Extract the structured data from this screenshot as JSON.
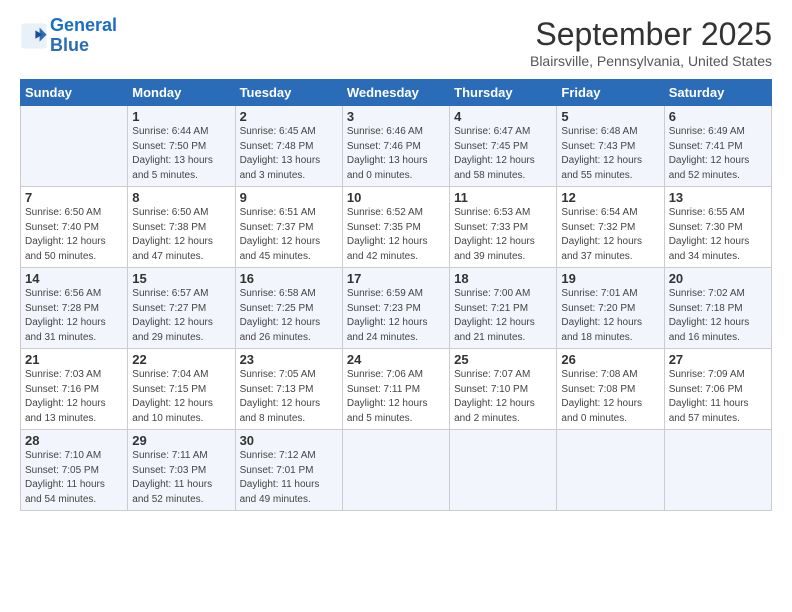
{
  "header": {
    "logo_line1": "General",
    "logo_line2": "Blue",
    "month": "September 2025",
    "location": "Blairsville, Pennsylvania, United States"
  },
  "days_of_week": [
    "Sunday",
    "Monday",
    "Tuesday",
    "Wednesday",
    "Thursday",
    "Friday",
    "Saturday"
  ],
  "weeks": [
    [
      {
        "day": "",
        "info": ""
      },
      {
        "day": "1",
        "info": "Sunrise: 6:44 AM\nSunset: 7:50 PM\nDaylight: 13 hours\nand 5 minutes."
      },
      {
        "day": "2",
        "info": "Sunrise: 6:45 AM\nSunset: 7:48 PM\nDaylight: 13 hours\nand 3 minutes."
      },
      {
        "day": "3",
        "info": "Sunrise: 6:46 AM\nSunset: 7:46 PM\nDaylight: 13 hours\nand 0 minutes."
      },
      {
        "day": "4",
        "info": "Sunrise: 6:47 AM\nSunset: 7:45 PM\nDaylight: 12 hours\nand 58 minutes."
      },
      {
        "day": "5",
        "info": "Sunrise: 6:48 AM\nSunset: 7:43 PM\nDaylight: 12 hours\nand 55 minutes."
      },
      {
        "day": "6",
        "info": "Sunrise: 6:49 AM\nSunset: 7:41 PM\nDaylight: 12 hours\nand 52 minutes."
      }
    ],
    [
      {
        "day": "7",
        "info": "Sunrise: 6:50 AM\nSunset: 7:40 PM\nDaylight: 12 hours\nand 50 minutes."
      },
      {
        "day": "8",
        "info": "Sunrise: 6:50 AM\nSunset: 7:38 PM\nDaylight: 12 hours\nand 47 minutes."
      },
      {
        "day": "9",
        "info": "Sunrise: 6:51 AM\nSunset: 7:37 PM\nDaylight: 12 hours\nand 45 minutes."
      },
      {
        "day": "10",
        "info": "Sunrise: 6:52 AM\nSunset: 7:35 PM\nDaylight: 12 hours\nand 42 minutes."
      },
      {
        "day": "11",
        "info": "Sunrise: 6:53 AM\nSunset: 7:33 PM\nDaylight: 12 hours\nand 39 minutes."
      },
      {
        "day": "12",
        "info": "Sunrise: 6:54 AM\nSunset: 7:32 PM\nDaylight: 12 hours\nand 37 minutes."
      },
      {
        "day": "13",
        "info": "Sunrise: 6:55 AM\nSunset: 7:30 PM\nDaylight: 12 hours\nand 34 minutes."
      }
    ],
    [
      {
        "day": "14",
        "info": "Sunrise: 6:56 AM\nSunset: 7:28 PM\nDaylight: 12 hours\nand 31 minutes."
      },
      {
        "day": "15",
        "info": "Sunrise: 6:57 AM\nSunset: 7:27 PM\nDaylight: 12 hours\nand 29 minutes."
      },
      {
        "day": "16",
        "info": "Sunrise: 6:58 AM\nSunset: 7:25 PM\nDaylight: 12 hours\nand 26 minutes."
      },
      {
        "day": "17",
        "info": "Sunrise: 6:59 AM\nSunset: 7:23 PM\nDaylight: 12 hours\nand 24 minutes."
      },
      {
        "day": "18",
        "info": "Sunrise: 7:00 AM\nSunset: 7:21 PM\nDaylight: 12 hours\nand 21 minutes."
      },
      {
        "day": "19",
        "info": "Sunrise: 7:01 AM\nSunset: 7:20 PM\nDaylight: 12 hours\nand 18 minutes."
      },
      {
        "day": "20",
        "info": "Sunrise: 7:02 AM\nSunset: 7:18 PM\nDaylight: 12 hours\nand 16 minutes."
      }
    ],
    [
      {
        "day": "21",
        "info": "Sunrise: 7:03 AM\nSunset: 7:16 PM\nDaylight: 12 hours\nand 13 minutes."
      },
      {
        "day": "22",
        "info": "Sunrise: 7:04 AM\nSunset: 7:15 PM\nDaylight: 12 hours\nand 10 minutes."
      },
      {
        "day": "23",
        "info": "Sunrise: 7:05 AM\nSunset: 7:13 PM\nDaylight: 12 hours\nand 8 minutes."
      },
      {
        "day": "24",
        "info": "Sunrise: 7:06 AM\nSunset: 7:11 PM\nDaylight: 12 hours\nand 5 minutes."
      },
      {
        "day": "25",
        "info": "Sunrise: 7:07 AM\nSunset: 7:10 PM\nDaylight: 12 hours\nand 2 minutes."
      },
      {
        "day": "26",
        "info": "Sunrise: 7:08 AM\nSunset: 7:08 PM\nDaylight: 12 hours\nand 0 minutes."
      },
      {
        "day": "27",
        "info": "Sunrise: 7:09 AM\nSunset: 7:06 PM\nDaylight: 11 hours\nand 57 minutes."
      }
    ],
    [
      {
        "day": "28",
        "info": "Sunrise: 7:10 AM\nSunset: 7:05 PM\nDaylight: 11 hours\nand 54 minutes."
      },
      {
        "day": "29",
        "info": "Sunrise: 7:11 AM\nSunset: 7:03 PM\nDaylight: 11 hours\nand 52 minutes."
      },
      {
        "day": "30",
        "info": "Sunrise: 7:12 AM\nSunset: 7:01 PM\nDaylight: 11 hours\nand 49 minutes."
      },
      {
        "day": "",
        "info": ""
      },
      {
        "day": "",
        "info": ""
      },
      {
        "day": "",
        "info": ""
      },
      {
        "day": "",
        "info": ""
      }
    ]
  ]
}
